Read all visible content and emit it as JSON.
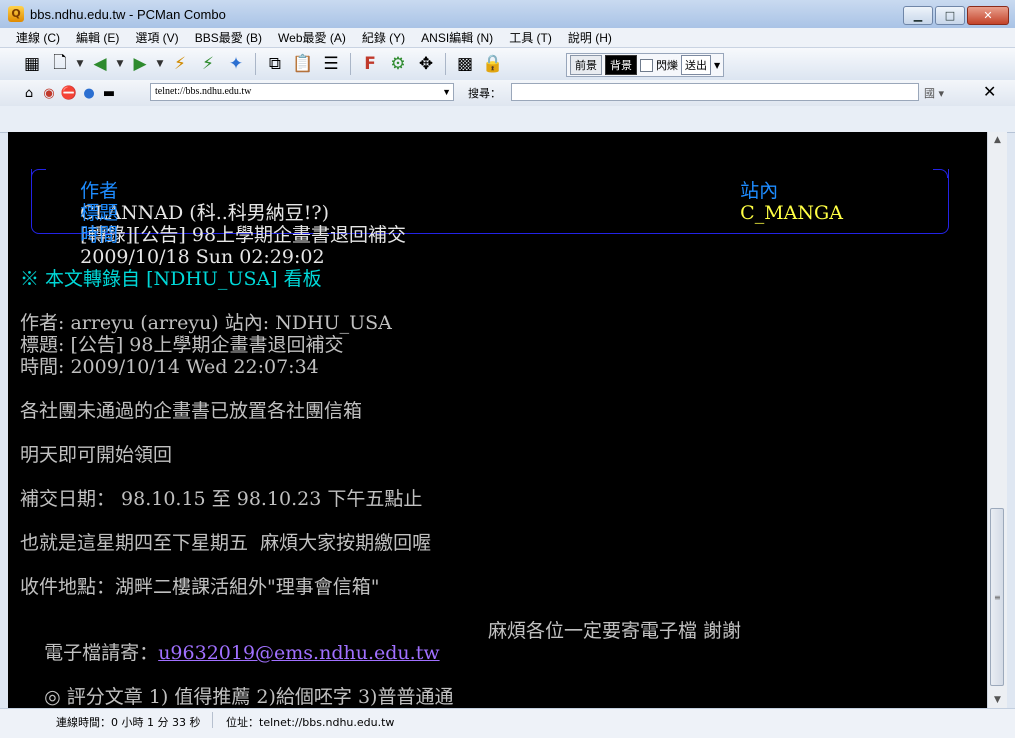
{
  "window": {
    "title": "bbs.ndhu.edu.tw - PCMan Combo"
  },
  "menu": [
    "連線 (C)",
    "編輯 (E)",
    "選項 (V)",
    "BBS最愛 (B)",
    "Web最愛 (A)",
    "紀錄 (Y)",
    "ANSI編輯 (N)",
    "工具 (T)",
    "說明 (H)"
  ],
  "toolbar": {
    "foreground_label": "前景",
    "background_label": "背景",
    "blink_label": "閃爍",
    "send_label": "送出"
  },
  "address": {
    "value": "telnet://bbs.ndhu.edu.tw"
  },
  "search": {
    "label": "搜尋：",
    "value": "",
    "engine_label": "國"
  },
  "terminal": {
    "header": {
      "author_label": "作者",
      "author": "CLANNAD (科..科男納豆!?)",
      "board_label": "站內",
      "board": "C_MANGA",
      "title_label": "標題",
      "title": "[轉錄][公告] 98上學期企畫書退回補交",
      "time_label": "時間",
      "time": "2009/10/18 Sun 02:29:02"
    },
    "repost_line": "※ 本文轉錄自 [NDHU_USA] 看板",
    "orig_author": "作者: arreyu (arreyu) 站內: NDHU_USA",
    "orig_title": "標題: [公告] 98上學期企畫書退回補交",
    "orig_time": "時間: 2009/10/14 Wed 22:07:34",
    "body1": "各社團未通過的企畫書已放置各社團信箱",
    "body2": "明天即可開始領回",
    "body3": "補交日期： 98.10.15 至 98.10.23 下午五點止",
    "body4": "也就是這星期四至下星期五  麻煩大家按期繳回喔",
    "body5": "收件地點：湖畔二樓課活組外\"理事會信箱\"",
    "email_label": "電子檔請寄：",
    "email": "u9632019@ems.ndhu.edu.tw",
    "email_note": "麻煩各位一定要寄電子檔 謝謝",
    "rating": "◎ 評分文章 1) 值得推薦 2)給個呸字 3)普普通通"
  },
  "status": {
    "connect_time": "連線時間：0 小時 1 分 33 秒",
    "address": "位址：telnet://bbs.ndhu.edu.tw"
  }
}
